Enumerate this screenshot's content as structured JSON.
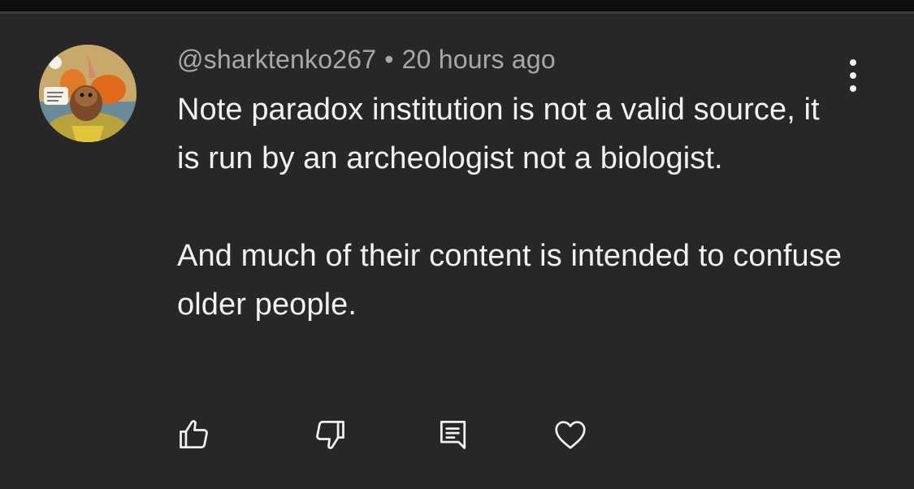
{
  "comment": {
    "author": "@sharktenko267",
    "separator": "•",
    "timestamp": "20 hours ago",
    "paragraphs": [
      "Note paradox institution is not a valid source, it is run by an archeologist not a biologist.",
      "And much of their content is intended to confuse older people."
    ],
    "avatar": "cartoon-character-avatar"
  },
  "actions": {
    "like": "thumbs-up-icon",
    "dislike": "thumbs-down-icon",
    "reply": "reply-comment-icon",
    "heart": "heart-icon",
    "more": "more-vertical-icon"
  },
  "colors": {
    "background": "#272727",
    "text": "#f1f1f1",
    "meta": "#a8a8a8",
    "icon": "#f1f1f1"
  }
}
